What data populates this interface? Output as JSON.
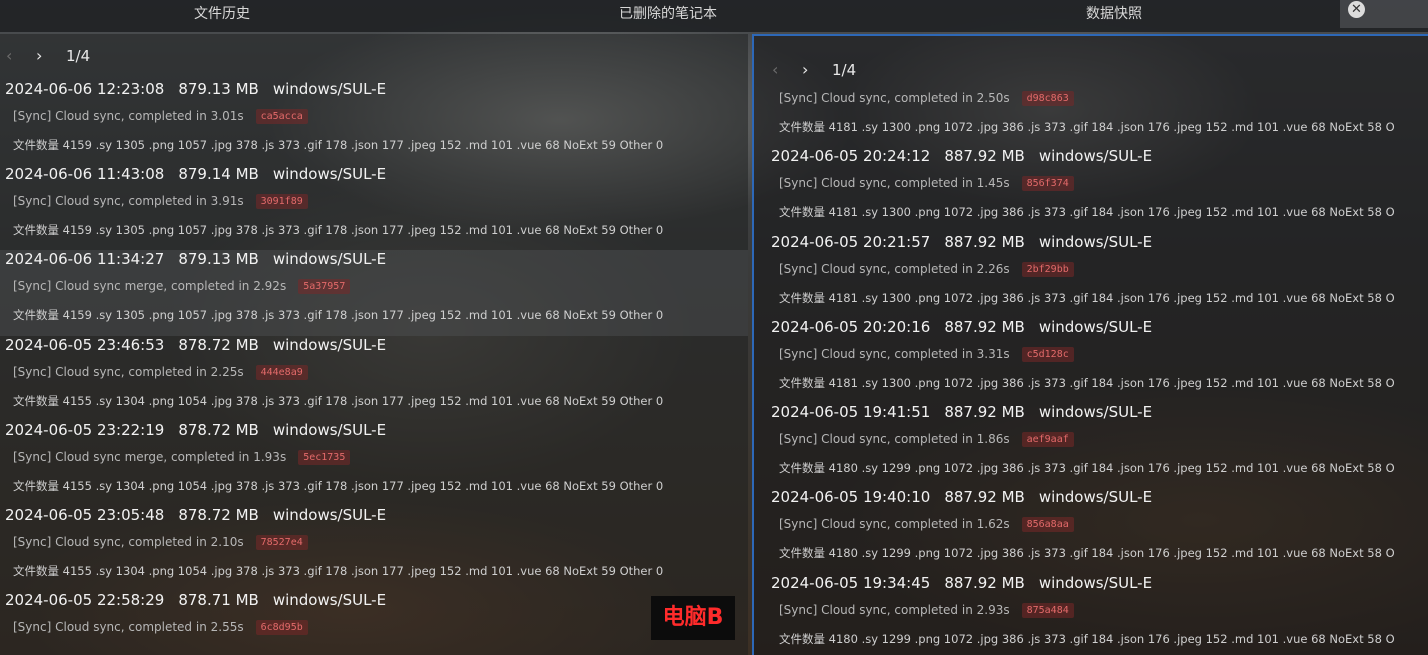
{
  "tabs": [
    {
      "label": "文件历史"
    },
    {
      "label": "已删除的笔记本"
    },
    {
      "label": "数据快照"
    }
  ],
  "close_icon": "close-icon",
  "left_panel": {
    "pager": {
      "prev_icon": "chevron-left-icon",
      "next_icon": "chevron-right-icon",
      "page": "1/4"
    },
    "entries": [
      {
        "time": "2024-06-06 12:23:08",
        "size": "879.13 MB",
        "device": "windows/SUL-E",
        "message": "[Sync] Cloud sync, completed in 3.01s",
        "hash": "ca5acca",
        "stats": "文件数量 4159 .sy 1305 .png 1057 .jpg 378 .js 373 .gif 178 .json 177 .jpeg 152 .md 101 .vue 68 NoExt 59 Other 0"
      },
      {
        "time": "2024-06-06 11:43:08",
        "size": "879.14 MB",
        "device": "windows/SUL-E",
        "message": "[Sync] Cloud sync, completed in 3.91s",
        "hash": "3091f89",
        "stats": "文件数量 4159 .sy 1305 .png 1057 .jpg 378 .js 373 .gif 178 .json 177 .jpeg 152 .md 101 .vue 68 NoExt 59 Other 0"
      },
      {
        "time": "2024-06-06 11:34:27",
        "size": "879.13 MB",
        "device": "windows/SUL-E",
        "message": "[Sync] Cloud sync merge, completed in 2.92s",
        "hash": "5a37957",
        "stats": "文件数量 4159 .sy 1305 .png 1057 .jpg 378 .js 373 .gif 178 .json 177 .jpeg 152 .md 101 .vue 68 NoExt 59 Other 0"
      },
      {
        "time": "2024-06-05 23:46:53",
        "size": "878.72 MB",
        "device": "windows/SUL-E",
        "message": "[Sync] Cloud sync, completed in 2.25s",
        "hash": "444e8a9",
        "stats": "文件数量 4155 .sy 1304 .png 1054 .jpg 378 .js 373 .gif 178 .json 177 .jpeg 152 .md 101 .vue 68 NoExt 59 Other 0"
      },
      {
        "time": "2024-06-05 23:22:19",
        "size": "878.72 MB",
        "device": "windows/SUL-E",
        "message": "[Sync] Cloud sync merge, completed in 1.93s",
        "hash": "5ec1735",
        "stats": "文件数量 4155 .sy 1304 .png 1054 .jpg 378 .js 373 .gif 178 .json 177 .jpeg 152 .md 101 .vue 68 NoExt 59 Other 0"
      },
      {
        "time": "2024-06-05 23:05:48",
        "size": "878.72 MB",
        "device": "windows/SUL-E",
        "message": "[Sync] Cloud sync, completed in 2.10s",
        "hash": "78527e4",
        "stats": "文件数量 4155 .sy 1304 .png 1054 .jpg 378 .js 373 .gif 178 .json 177 .jpeg 152 .md 101 .vue 68 NoExt 59 Other 0"
      },
      {
        "time": "2024-06-05 22:58:29",
        "size": "878.71 MB",
        "device": "windows/SUL-E",
        "message": "[Sync] Cloud sync, completed in 2.55s",
        "hash": "6c8d95b",
        "stats": ""
      }
    ]
  },
  "right_panel": {
    "pager": {
      "prev_icon": "chevron-left-icon",
      "next_icon": "chevron-right-icon",
      "page": "1/4"
    },
    "first_partial": {
      "message": "[Sync] Cloud sync, completed in 2.50s",
      "hash": "d98c863",
      "stats": "文件数量 4181 .sy 1300 .png 1072 .jpg 386 .js 373 .gif 184 .json 176 .jpeg 152 .md 101 .vue 68 NoExt 58 O"
    },
    "entries": [
      {
        "time": "2024-06-05 20:24:12",
        "size": "887.92 MB",
        "device": "windows/SUL-E",
        "message": "[Sync] Cloud sync, completed in 1.45s",
        "hash": "856f374",
        "stats": "文件数量 4181 .sy 1300 .png 1072 .jpg 386 .js 373 .gif 184 .json 176 .jpeg 152 .md 101 .vue 68 NoExt 58 O"
      },
      {
        "time": "2024-06-05 20:21:57",
        "size": "887.92 MB",
        "device": "windows/SUL-E",
        "message": "[Sync] Cloud sync, completed in 2.26s",
        "hash": "2bf29bb",
        "stats": "文件数量 4181 .sy 1300 .png 1072 .jpg 386 .js 373 .gif 184 .json 176 .jpeg 152 .md 101 .vue 68 NoExt 58 O"
      },
      {
        "time": "2024-06-05 20:20:16",
        "size": "887.92 MB",
        "device": "windows/SUL-E",
        "message": "[Sync] Cloud sync, completed in 3.31s",
        "hash": "c5d128c",
        "stats": "文件数量 4181 .sy 1300 .png 1072 .jpg 386 .js 373 .gif 184 .json 176 .jpeg 152 .md 101 .vue 68 NoExt 58 O"
      },
      {
        "time": "2024-06-05 19:41:51",
        "size": "887.92 MB",
        "device": "windows/SUL-E",
        "message": "[Sync] Cloud sync, completed in 1.86s",
        "hash": "aef9aaf",
        "stats": "文件数量 4180 .sy 1299 .png 1072 .jpg 386 .js 373 .gif 184 .json 176 .jpeg 152 .md 101 .vue 68 NoExt 58 O"
      },
      {
        "time": "2024-06-05 19:40:10",
        "size": "887.92 MB",
        "device": "windows/SUL-E",
        "message": "[Sync] Cloud sync, completed in 1.62s",
        "hash": "856a8aa",
        "stats": "文件数量 4180 .sy 1299 .png 1072 .jpg 386 .js 373 .gif 184 .json 176 .jpeg 152 .md 101 .vue 68 NoExt 58 O"
      },
      {
        "time": "2024-06-05 19:34:45",
        "size": "887.92 MB",
        "device": "windows/SUL-E",
        "message": "[Sync] Cloud sync, completed in 2.93s",
        "hash": "875a484",
        "stats": "文件数量 4180 .sy 1299 .png 1072 .jpg 386 .js 373 .gif 184 .json 176 .jpeg 152 .md 101 .vue 68 NoExt 58 O"
      }
    ]
  },
  "watermark": "电脑B",
  "colors": {
    "accent_border": "#2d68b8",
    "hash_text": "#e36a6a",
    "watermark_text": "#ff2b2b"
  }
}
